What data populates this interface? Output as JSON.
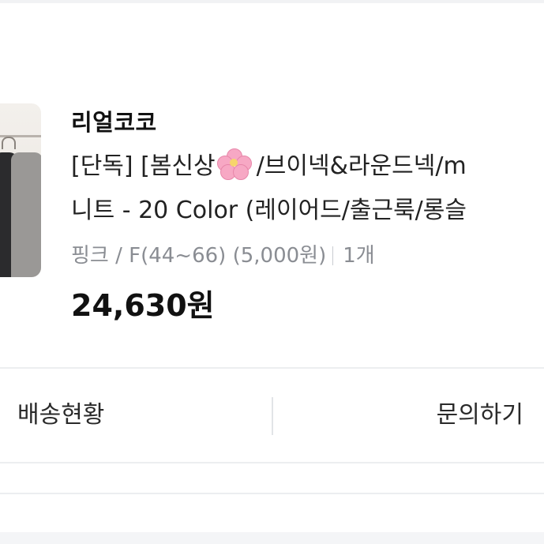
{
  "order": {
    "shop_name": "리얼코코",
    "title_line1_prefix": "[단독] [봄신상",
    "title_line1_suffix": "/브이넥&라운드넥/m",
    "title_line2": "니트 - 20 Color (레이어드/출근룩/롱슬",
    "option": "핑크 / F(44~66)  (5,000원)",
    "quantity": "1개",
    "price": "24,630원",
    "emoji_icon": "cherry-blossom-icon"
  },
  "actions": {
    "delivery_label": "배송현황",
    "inquiry_label": "문의하기"
  },
  "colors": {
    "divider": "#eceef0",
    "option_text": "#8a8d93"
  }
}
